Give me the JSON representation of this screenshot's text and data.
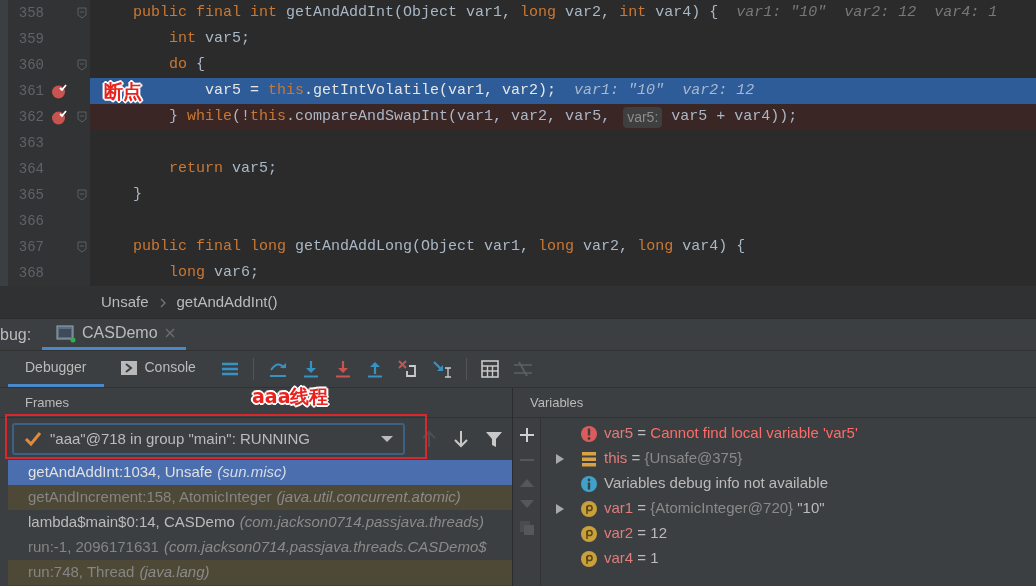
{
  "editor": {
    "annotation": {
      "text": "断点"
    },
    "lines": [
      {
        "number": "358",
        "breakpoint": false,
        "current": false,
        "fold_marker": true,
        "tokens": [
          {
            "kind": "kw",
            "text": "    public final int"
          },
          {
            "kind": "plain",
            "text": " getAndAddInt(Object var1, "
          },
          {
            "kind": "kw",
            "text": "long"
          },
          {
            "kind": "plain",
            "text": " var2, "
          },
          {
            "kind": "kw",
            "text": "int"
          },
          {
            "kind": "plain",
            "text": " var4) {"
          },
          {
            "kind": "hint",
            "text": "var1: \"10\""
          },
          {
            "kind": "hint",
            "text": "var2: 12"
          },
          {
            "kind": "hint",
            "text": "var4: 1"
          }
        ]
      },
      {
        "number": "359",
        "breakpoint": false,
        "current": false,
        "fold_marker": false,
        "tokens": [
          {
            "kind": "kw",
            "text": "        int"
          },
          {
            "kind": "plain",
            "text": " var5;"
          }
        ]
      },
      {
        "number": "360",
        "breakpoint": false,
        "current": false,
        "fold_marker": true,
        "tokens": [
          {
            "kind": "kw",
            "text": "        do"
          },
          {
            "kind": "plain",
            "text": " {"
          }
        ]
      },
      {
        "number": "361",
        "breakpoint": true,
        "current": true,
        "fold_marker": false,
        "tokens": [
          {
            "kind": "plain",
            "text": "            var5 = "
          },
          {
            "kind": "kw",
            "text": "this"
          },
          {
            "kind": "plain",
            "text": ".getIntVolatile(var1, var2);"
          },
          {
            "kind": "hint",
            "text": "var1: \"10\""
          },
          {
            "kind": "hint",
            "text": "var2: 12"
          }
        ]
      },
      {
        "number": "362",
        "breakpoint": true,
        "current": false,
        "fold_marker": true,
        "tokens": [
          {
            "kind": "plain",
            "text": "        } "
          },
          {
            "kind": "kw",
            "text": "while"
          },
          {
            "kind": "plain",
            "text": "(!"
          },
          {
            "kind": "kw",
            "text": "this"
          },
          {
            "kind": "plain",
            "text": ".compareAndSwapInt(var1, var2, var5, "
          },
          {
            "kind": "inlay",
            "text": "var5:"
          },
          {
            "kind": "plain",
            "text": " var5 + var4));"
          }
        ]
      },
      {
        "number": "363",
        "breakpoint": false,
        "current": false,
        "fold_marker": false
      },
      {
        "number": "364",
        "breakpoint": false,
        "current": false,
        "fold_marker": false,
        "tokens": [
          {
            "kind": "kw",
            "text": "        return"
          },
          {
            "kind": "plain",
            "text": " var5;"
          }
        ]
      },
      {
        "number": "365",
        "breakpoint": false,
        "current": false,
        "fold_marker": true,
        "tokens": [
          {
            "kind": "plain",
            "text": "    }"
          }
        ]
      },
      {
        "number": "366",
        "breakpoint": false,
        "current": false,
        "fold_marker": false
      },
      {
        "number": "367",
        "breakpoint": false,
        "current": false,
        "fold_marker": true,
        "tokens": [
          {
            "kind": "kw",
            "text": "    public final long"
          },
          {
            "kind": "plain",
            "text": " getAndAddLong(Object var1, "
          },
          {
            "kind": "kw",
            "text": "long"
          },
          {
            "kind": "plain",
            "text": " var2, "
          },
          {
            "kind": "kw",
            "text": "long"
          },
          {
            "kind": "plain",
            "text": " var4) {"
          }
        ]
      },
      {
        "number": "368",
        "breakpoint": false,
        "current": false,
        "fold_marker": false,
        "tokens": [
          {
            "kind": "kw",
            "text": "        long"
          },
          {
            "kind": "plain",
            "text": " var6;"
          }
        ]
      }
    ]
  },
  "breadcrumbs": [
    "Unsafe",
    "getAndAddInt()"
  ],
  "debug_panel": {
    "label": "bug:",
    "session_tab": {
      "title": "CASDemo",
      "selected": true
    },
    "tabs": [
      {
        "label": "Debugger",
        "selected": true,
        "kind": "debugger"
      },
      {
        "label": "Console",
        "selected": false,
        "kind": "console"
      }
    ]
  },
  "frames": {
    "title": "Frames",
    "annotation": {
      "text": "aaa线程"
    },
    "thread": {
      "value": "\"aaa\"@718 in group \"main\": RUNNING"
    },
    "rows": [
      {
        "method": "getAndAddInt:1034, Unsafe",
        "package": "(sun.misc)",
        "selected": true,
        "library": false,
        "dimmed": false
      },
      {
        "method": "getAndIncrement:158, AtomicInteger",
        "package": "(java.util.concurrent.atomic)",
        "selected": false,
        "library": true,
        "dimmed": true
      },
      {
        "method": "lambda$main$0:14, CASDemo",
        "package": "(com.jackson0714.passjava.threads)",
        "selected": false,
        "library": false,
        "dimmed": false
      },
      {
        "method": "run:-1, 2096171631",
        "package": "(com.jackson0714.passjava.threads.CASDemo$",
        "selected": false,
        "library": false,
        "dimmed": true
      },
      {
        "method": "run:748, Thread",
        "package": "(java.lang)",
        "selected": false,
        "library": true,
        "dimmed": true
      }
    ]
  },
  "variables": {
    "title": "Variables",
    "rows": [
      {
        "kind": "error",
        "expandable": false,
        "name": "var5",
        "operator": "=",
        "value": "Cannot find local variable 'var5'"
      },
      {
        "kind": "object",
        "expandable": true,
        "name": "this",
        "operator": "=",
        "ref": "{Unsafe@375}"
      },
      {
        "kind": "info",
        "expandable": false,
        "message": "Variables debug info not available"
      },
      {
        "kind": "param",
        "expandable": true,
        "name": "var1",
        "operator": "=",
        "ref": "{AtomicInteger@720}",
        "value": "\"10\""
      },
      {
        "kind": "param",
        "expandable": false,
        "name": "var2",
        "operator": "=",
        "value": "12"
      },
      {
        "kind": "param",
        "expandable": false,
        "name": "var4",
        "operator": "=",
        "value": "1"
      }
    ]
  }
}
